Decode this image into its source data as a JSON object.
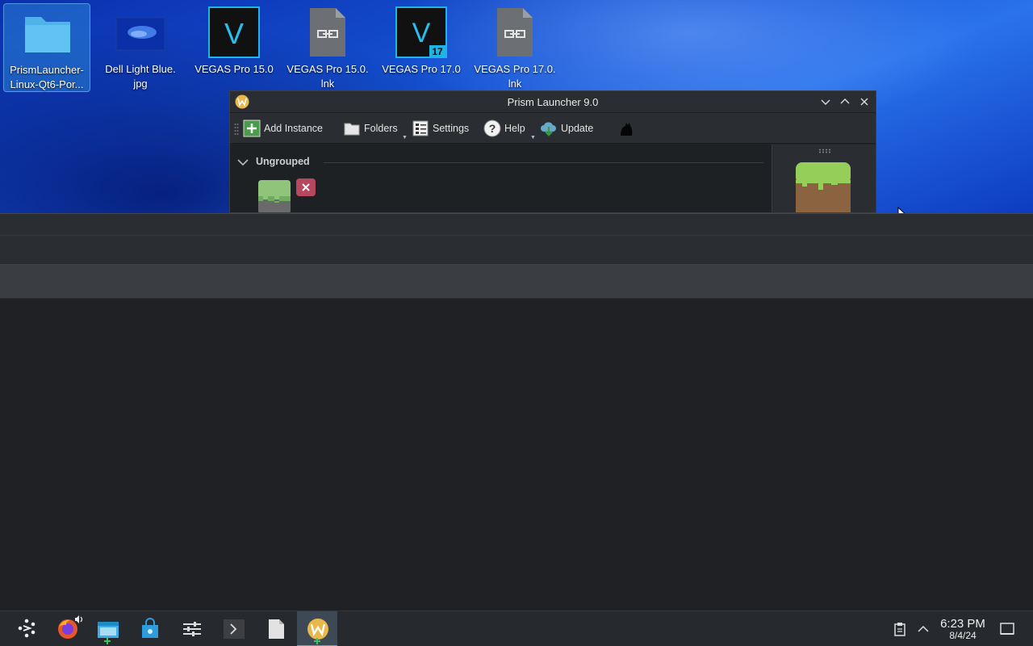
{
  "desktop": {
    "icons": [
      {
        "label": "PrismLauncher-\nLinux-Qt6-Por...",
        "icon": "folder-icon"
      },
      {
        "label": "Dell Light Blue.\njpg",
        "icon": "image-icon"
      },
      {
        "label": "VEGAS Pro 15.0",
        "icon": "vegas-icon"
      },
      {
        "label": "VEGAS Pro 15.0.\nlnk",
        "icon": "shortcut-file-icon"
      },
      {
        "label": "VEGAS Pro 17.0",
        "icon": "vegas17-icon",
        "badge": "17"
      },
      {
        "label": "VEGAS Pro 17.0.\nlnk",
        "icon": "shortcut-file-icon"
      }
    ],
    "vegas_letter": "V"
  },
  "window": {
    "title": "Prism Launcher 9.0",
    "toolbar": {
      "add_instance": "Add Instance",
      "folders": "Folders",
      "settings": "Settings",
      "help": "Help",
      "update": "Update"
    },
    "group_name": "Ungrouped"
  },
  "taskbar": {
    "time": "6:23 PM",
    "date": "8/4/24"
  },
  "colors": {
    "accent": "#3daee9",
    "wallpaper": "#1656d6",
    "panel": "#26292d"
  }
}
